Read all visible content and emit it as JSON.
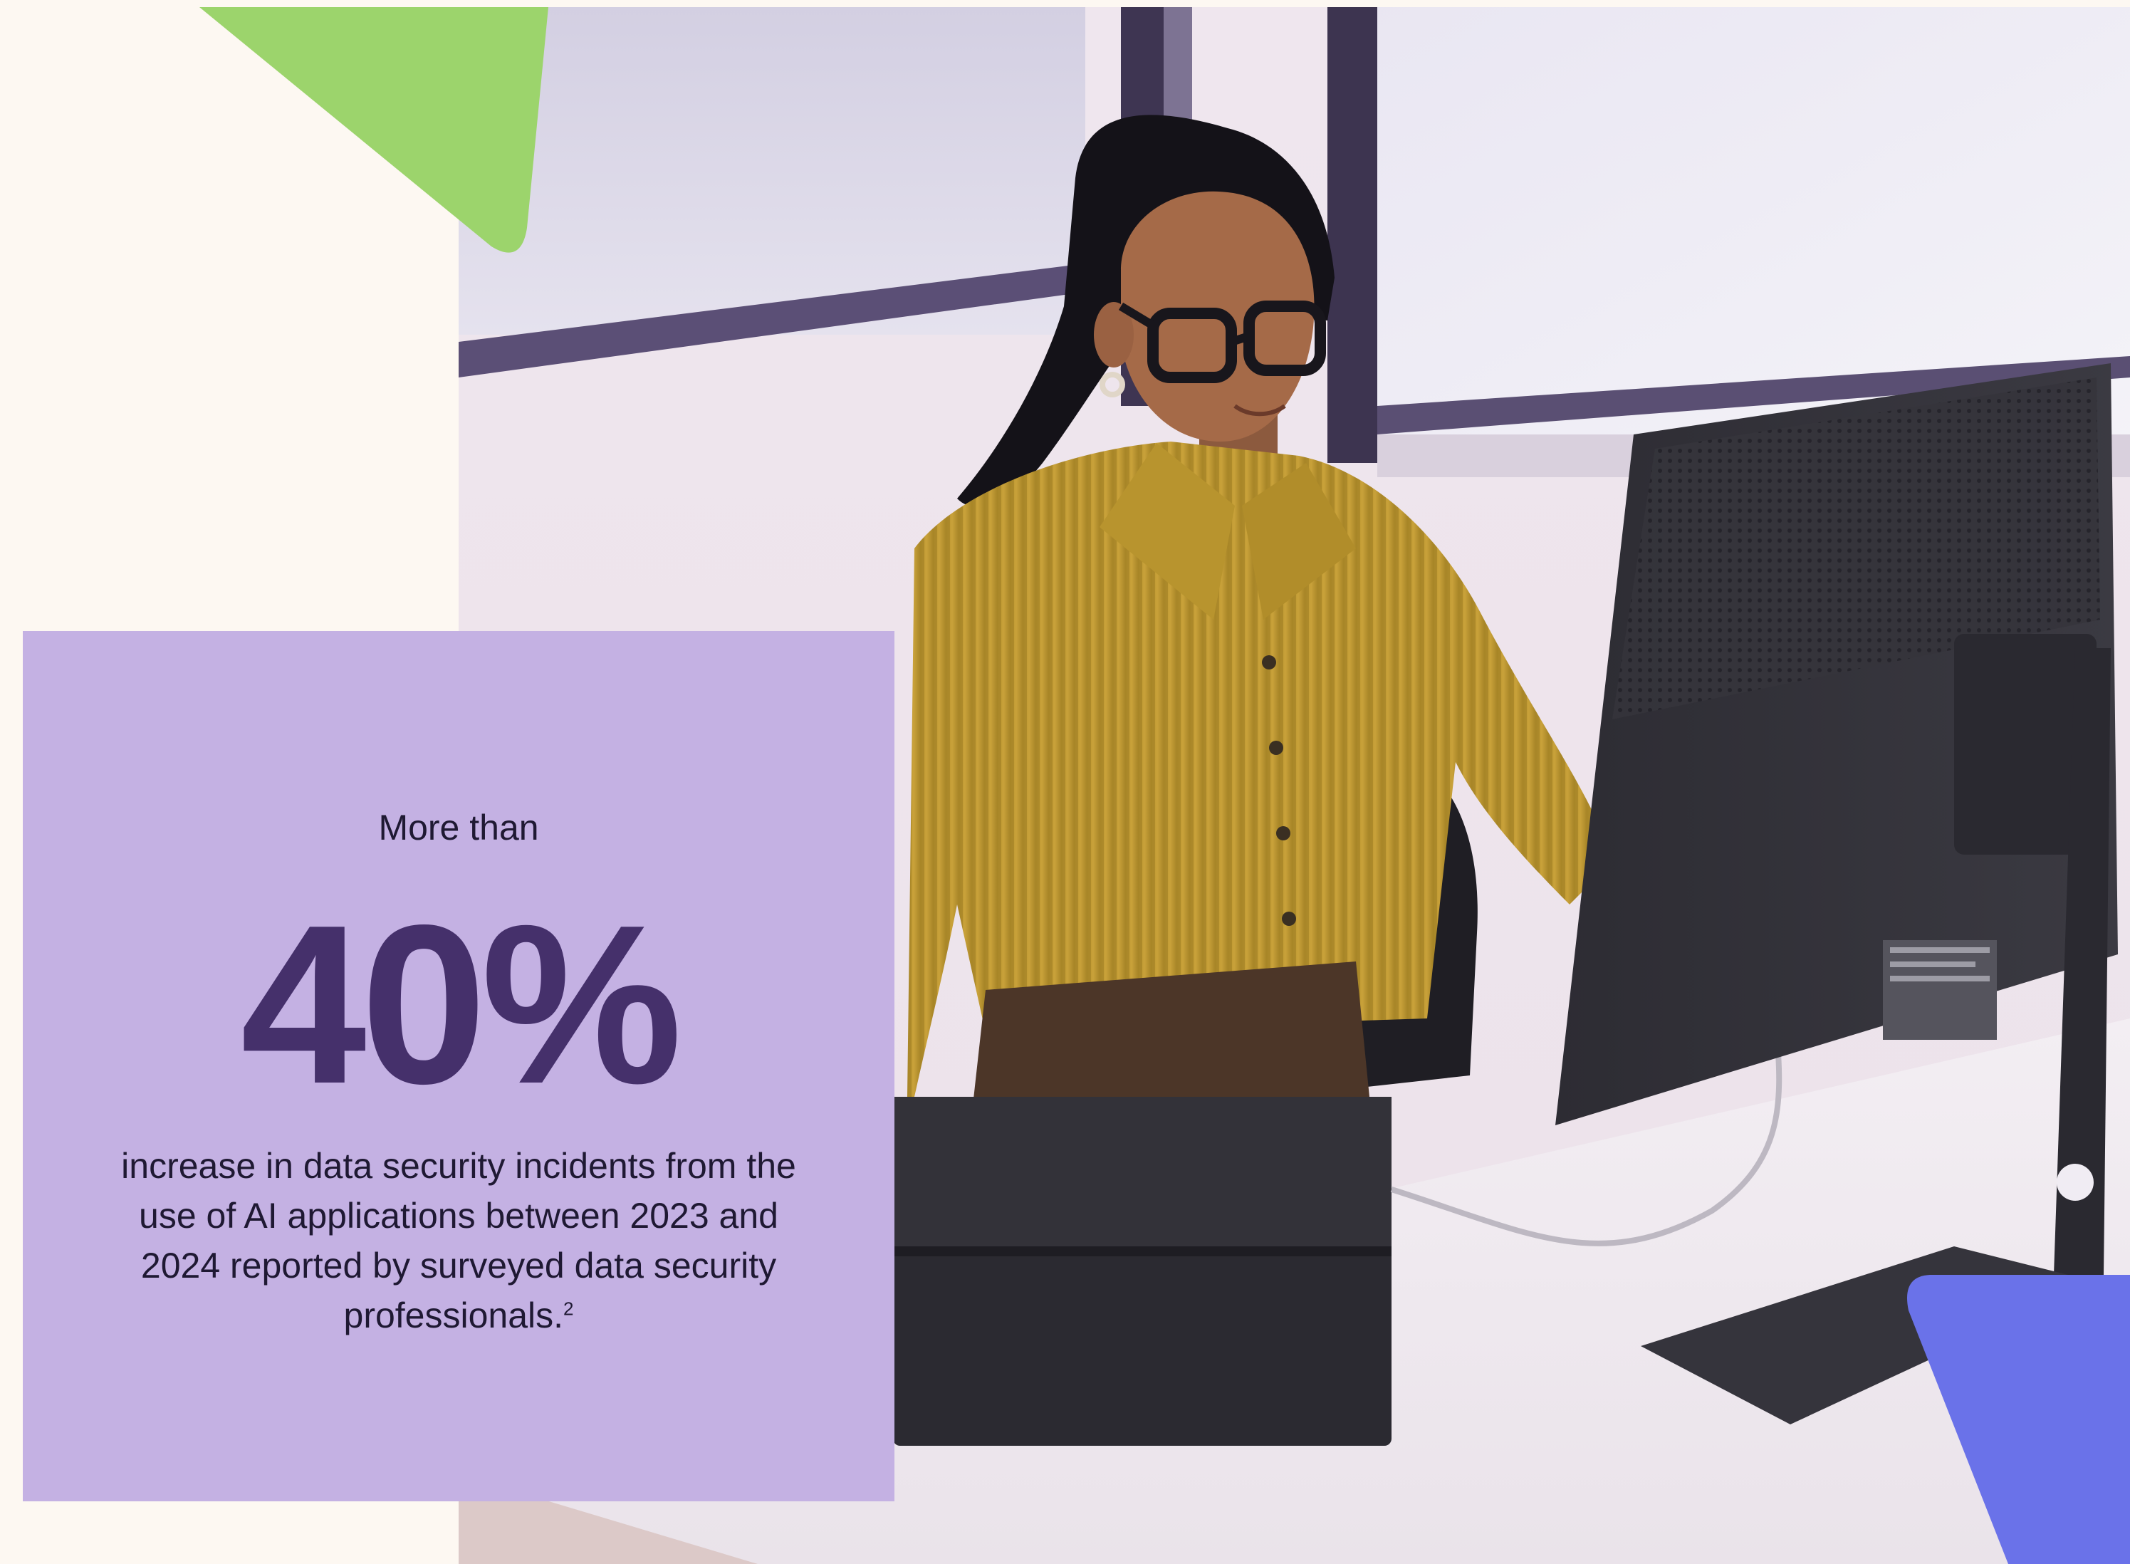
{
  "stat": {
    "pre_label": "More than",
    "value": "40%",
    "description": "increase in data security incidents from the use of AI applications between 2023 and 2024 reported by surveyed data security professionals.",
    "footnote": "2"
  },
  "colors": {
    "card_bg": "#c4b1e3",
    "stat_value": "#45306b",
    "text_dark": "#1f1933",
    "page_bg": "#fdf8f2",
    "green_shape": "#9bd46c",
    "blue_shape": "#6a72e9"
  },
  "icons": {
    "photo": "woman-at-computer-photo",
    "green_triangle": "decorative-triangle",
    "blue_triangle": "decorative-triangle"
  }
}
